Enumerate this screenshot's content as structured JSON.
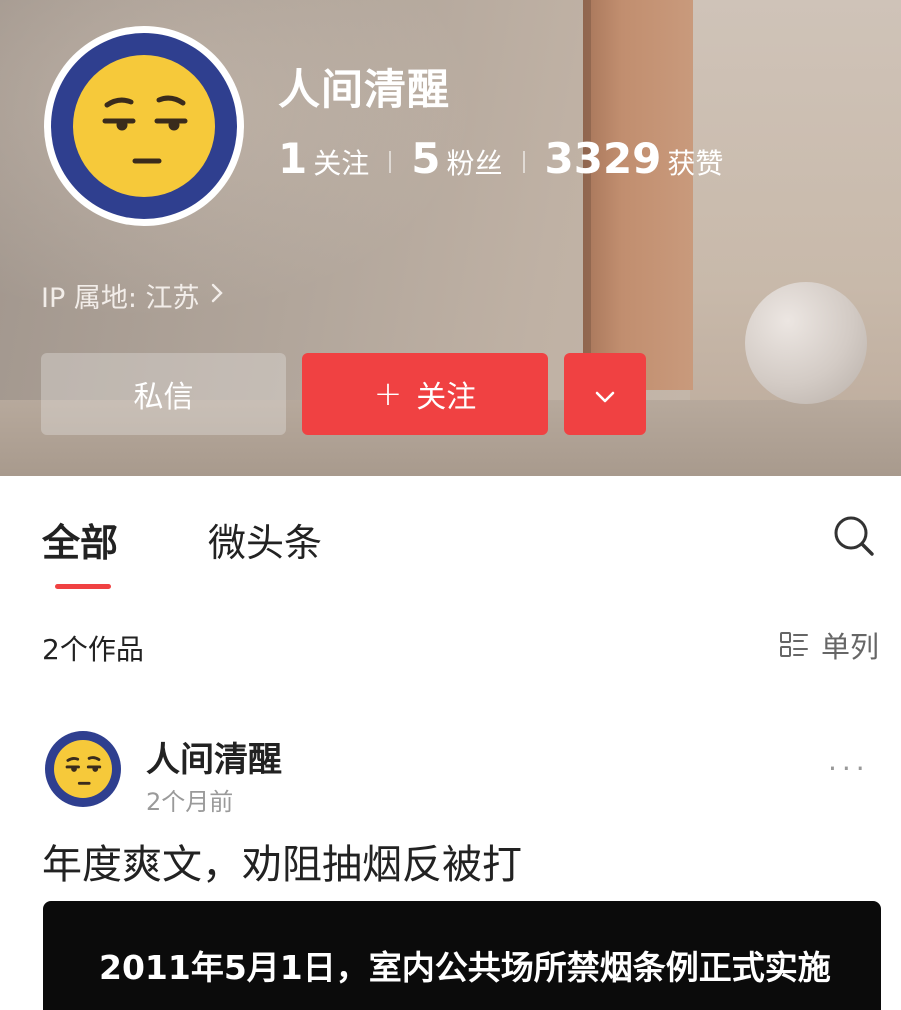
{
  "profile": {
    "name": "人间清醒",
    "stats": [
      {
        "value": "1",
        "label": "关注"
      },
      {
        "value": "5",
        "label": "粉丝"
      },
      {
        "value": "3329",
        "label": "获赞"
      }
    ],
    "ip_location": "IP 属地: 江苏",
    "buttons": {
      "message": "私信",
      "follow_plus": "+",
      "follow": "关注"
    },
    "colors": {
      "accent": "#f04142",
      "avatar_ring": "#2f3f8f",
      "avatar_face": "#f6c93a"
    }
  },
  "tabs": [
    {
      "label": "全部",
      "active": true
    },
    {
      "label": "微头条",
      "active": false
    }
  ],
  "works": {
    "count_label": "2个作品",
    "layout_toggle": "单列"
  },
  "post": {
    "author": "人间清醒",
    "time": "2个月前",
    "menu": "···",
    "title": "年度爽文，劝阻抽烟反被打",
    "image_caption": "2011年5月1日，室内公共场所禁烟条例正式实施"
  },
  "icons": {
    "search": "search-icon",
    "chevron_right": "chevron-right-icon",
    "chevron_down": "chevron-down-icon",
    "layout": "list-layout-icon",
    "more": "more-dots-icon"
  }
}
